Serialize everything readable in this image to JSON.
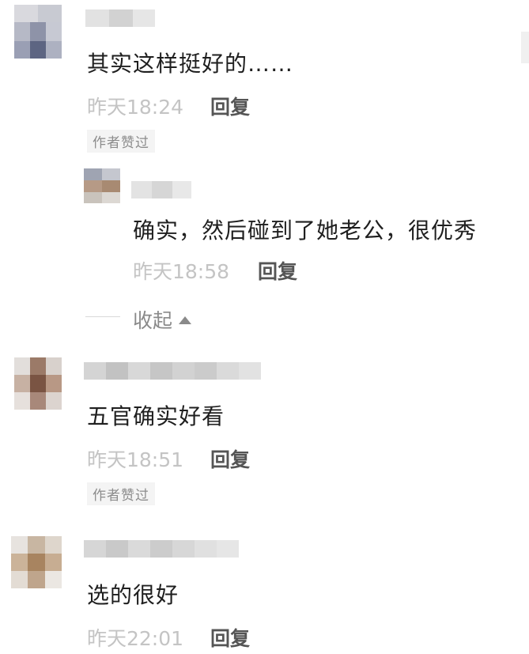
{
  "comments": [
    {
      "text": "其实这样挺好的……",
      "time": "昨天18:24",
      "reply_label": "回复",
      "badge": "作者赞过",
      "replies": [
        {
          "text": "确实，然后碰到了她老公，很优秀",
          "time": "昨天18:58",
          "reply_label": "回复"
        }
      ],
      "collapse_label": "收起"
    },
    {
      "text": "五官确实好看",
      "time": "昨天18:51",
      "reply_label": "回复",
      "badge": "作者赞过"
    },
    {
      "text": "选的很好",
      "time": "昨天22:01",
      "reply_label": "回复"
    }
  ],
  "colors": {
    "text": "#1f1f1f",
    "time": "#c4c4c4",
    "reply": "#555555",
    "badge_bg": "#f4f4f4",
    "badge_text": "#8c8c8c"
  },
  "icons": {
    "collapse": "triangle-up-icon"
  }
}
